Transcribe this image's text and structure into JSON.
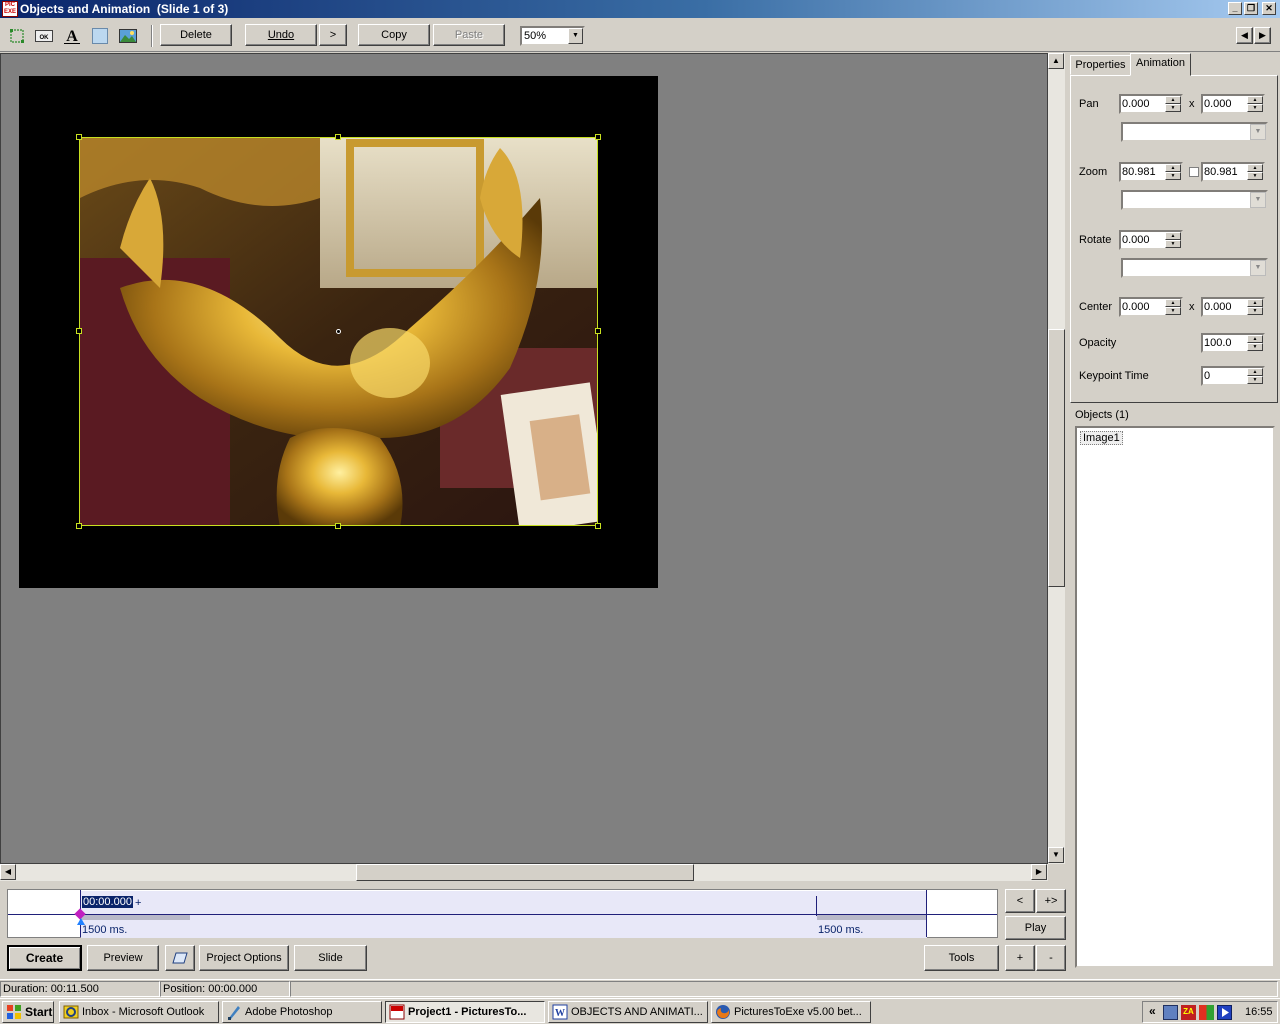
{
  "window": {
    "title": "Objects and Animation  (Slide 1 of 3)",
    "app_icon_text": "PIC EXE"
  },
  "toolbar": {
    "delete_label": "Delete",
    "undo_label": "Undo",
    "redo_label": ">",
    "copy_label": "Copy",
    "paste_label": "Paste",
    "zoom_value": "50%",
    "icons": [
      "rectangle-icon",
      "ok-button-icon",
      "text-icon",
      "frame-icon",
      "image-icon"
    ]
  },
  "tabs": [
    {
      "label": "Properties",
      "active": false
    },
    {
      "label": "Animation",
      "active": true
    }
  ],
  "animation": {
    "pan_label": "Pan",
    "pan_x": "0.000",
    "pan_y": "0.000",
    "zoom_label": "Zoom",
    "zoom_x": "80.981",
    "zoom_y": "80.981",
    "rotate_label": "Rotate",
    "rotate_value": "0.000",
    "center_label": "Center",
    "center_x": "0.000",
    "center_y": "0.000",
    "opacity_label": "Opacity",
    "opacity_value": "100.0",
    "keypoint_label": "Keypoint Time",
    "keypoint_value": "0",
    "x_sep": "x"
  },
  "objects": {
    "header": "Objects (1)",
    "items": [
      "Image1"
    ]
  },
  "timeline": {
    "current_time": "00:00.000",
    "plus": "+",
    "left_ms": "1500 ms.",
    "right_ms": "1500 ms."
  },
  "nav": {
    "prev": "<",
    "next": "+>",
    "play": "Play",
    "add": "+",
    "remove": "-"
  },
  "bottom_buttons": {
    "create": "Create",
    "preview": "Preview",
    "project_options": "Project Options",
    "slide": "Slide",
    "tools": "Tools"
  },
  "status": {
    "duration": "Duration:  00:11.500",
    "position": "Position:  00:00.000"
  },
  "taskbar": {
    "start": "Start",
    "items": [
      {
        "label": "Inbox - Microsoft Outlook",
        "active": false
      },
      {
        "label": "Adobe Photoshop",
        "active": false
      },
      {
        "label": "Project1 - PicturesTo...",
        "active": true
      },
      {
        "label": "OBJECTS AND ANIMATI...",
        "active": false
      },
      {
        "label": "PicturesToExe v5.00 bet...",
        "active": false
      }
    ],
    "clock": "16:55",
    "tray_expand": "«"
  }
}
